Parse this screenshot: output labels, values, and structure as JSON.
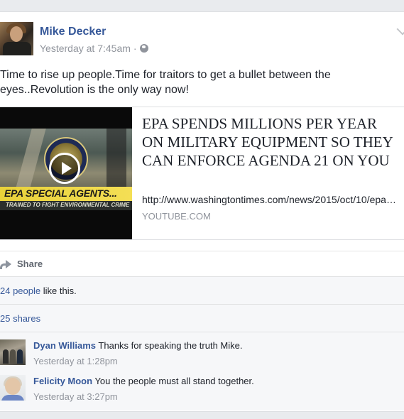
{
  "post": {
    "author": "Mike Decker",
    "timestamp": "Yesterday at 7:45am",
    "separator": "·",
    "privacy_icon": "globe-icon",
    "text": "Time to rise up people.Time for traitors to get a bullet between the eyes..Revolution is the only way now!"
  },
  "link_preview": {
    "title": "EPA SPENDS MILLIONS PER YEAR ON MILITARY EQUIPMENT SO THEY CAN ENFORCE AGENDA 21 ON YOU",
    "url": "http://www.washingtontimes.com/news/2015/oct/10/epa-spends-millions-military-equipment",
    "domain": "YOUTUBE.COM",
    "thumbnail_banner": "EPA SPECIAL AGENTS...",
    "thumbnail_subbanner": "TRAINED TO FIGHT ENVIRONMENTAL CRIME"
  },
  "actions": {
    "share_label": "Share"
  },
  "ufi": {
    "likes_link": "24 people",
    "likes_suffix": " like this.",
    "shares": "25 shares"
  },
  "comments": [
    {
      "author": "Dyan Williams",
      "text": "Thanks for speaking the truth Mike.",
      "timestamp": "Yesterday at 1:28pm"
    },
    {
      "author": "Felicity Moon",
      "text": "You the people must all stand together.",
      "timestamp": "Yesterday at 3:27pm"
    }
  ],
  "colors": {
    "link_blue": "#365899",
    "meta_gray": "#90949c",
    "text": "#1d2129",
    "ufi_bg": "#f6f7f9"
  }
}
